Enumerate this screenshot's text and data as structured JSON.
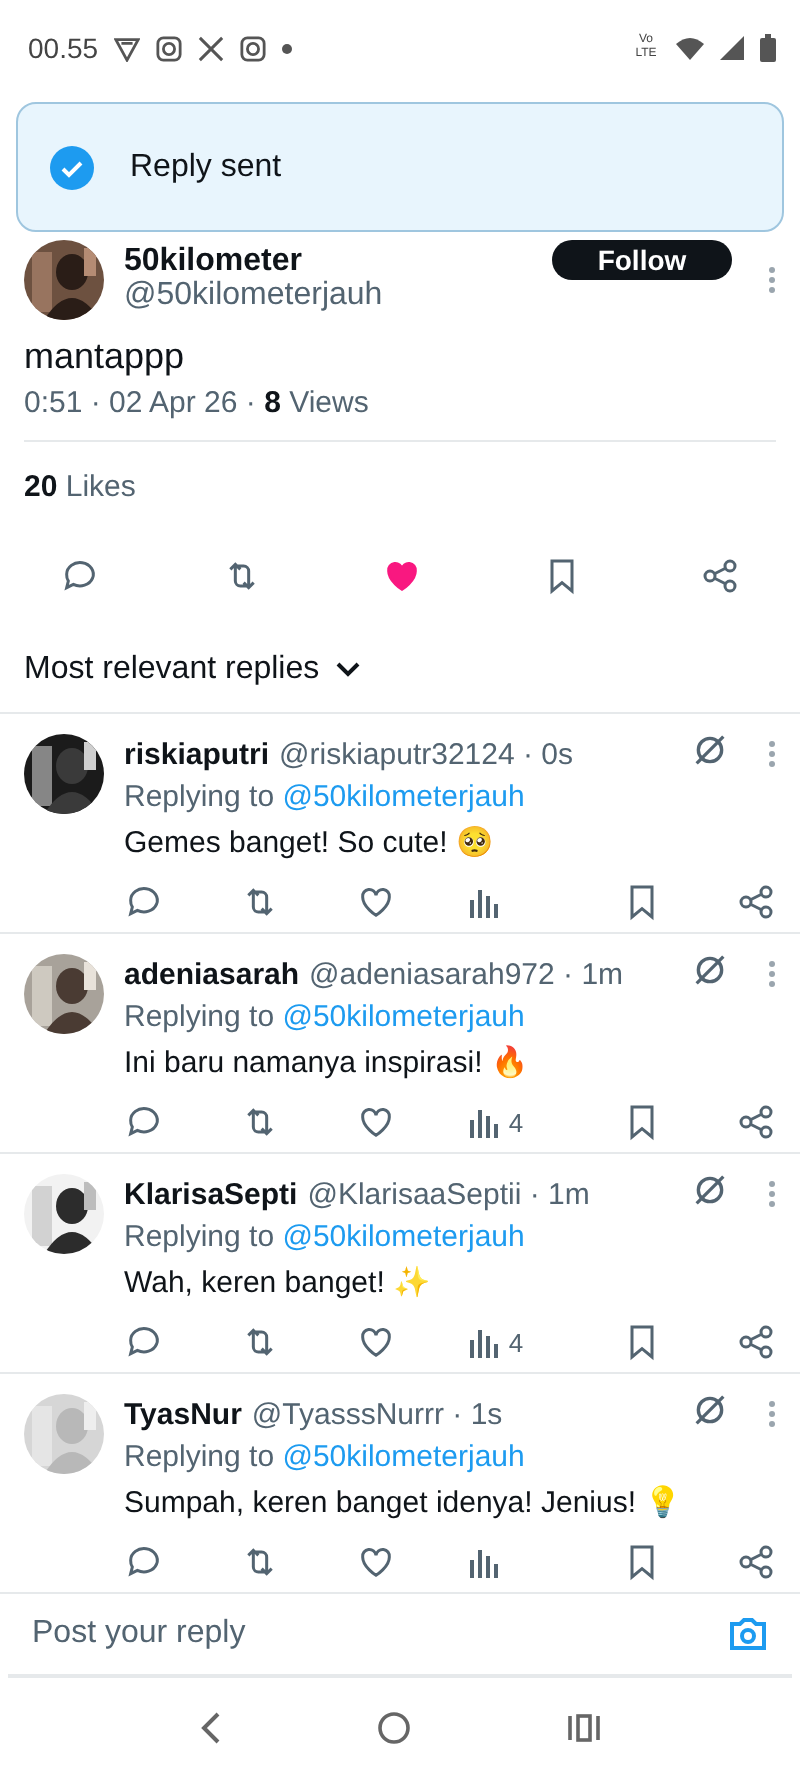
{
  "status_bar": {
    "time": "00.55",
    "network_label": "Vo LTE"
  },
  "toast": {
    "message": "Reply sent"
  },
  "post": {
    "author_name": "50kilometer",
    "author_handle": "@50kilometerjauh",
    "follow_label": "Follow",
    "text": "mantappp",
    "timestamp": "0:51 · 02 Apr 26 · ",
    "views_count": "8",
    "views_label": "Views",
    "likes_count": "20",
    "likes_label": "Likes",
    "liked": true,
    "bookmarked": false
  },
  "sort": {
    "label": "Most relevant replies"
  },
  "replies": [
    {
      "name": "riskiaputri",
      "handle_time": "@riskiaputr32124 · 0s",
      "replying_label": "Replying to",
      "replying_to": "@50kilometerjauh",
      "text": "Gemes banget! So cute! 🥺",
      "liked": false
    },
    {
      "name": "adeniasarah",
      "handle_time": "@adeniasarah972 · 1m",
      "replying_label": "Replying to",
      "replying_to": "@50kilometerjauh",
      "text": "Ini baru namanya inspirasi! 🔥",
      "views": "4",
      "liked": false
    },
    {
      "name": "KlarisaSepti",
      "handle_time": "@KlarisaaSeptii · 1m",
      "replying_label": "Replying to",
      "replying_to": "@50kilometerjauh",
      "text": "Wah, keren banget! ✨",
      "views": "4",
      "liked": false
    },
    {
      "name": "TyasNur",
      "handle_time": "@TyasssNurrr · 1s",
      "replying_label": "Replying to",
      "replying_to": "@50kilometerjauh",
      "text": "Sumpah, keren banget idenya! Jenius! 💡",
      "liked": false
    }
  ],
  "reply_bar": {
    "placeholder": "Post your reply"
  }
}
